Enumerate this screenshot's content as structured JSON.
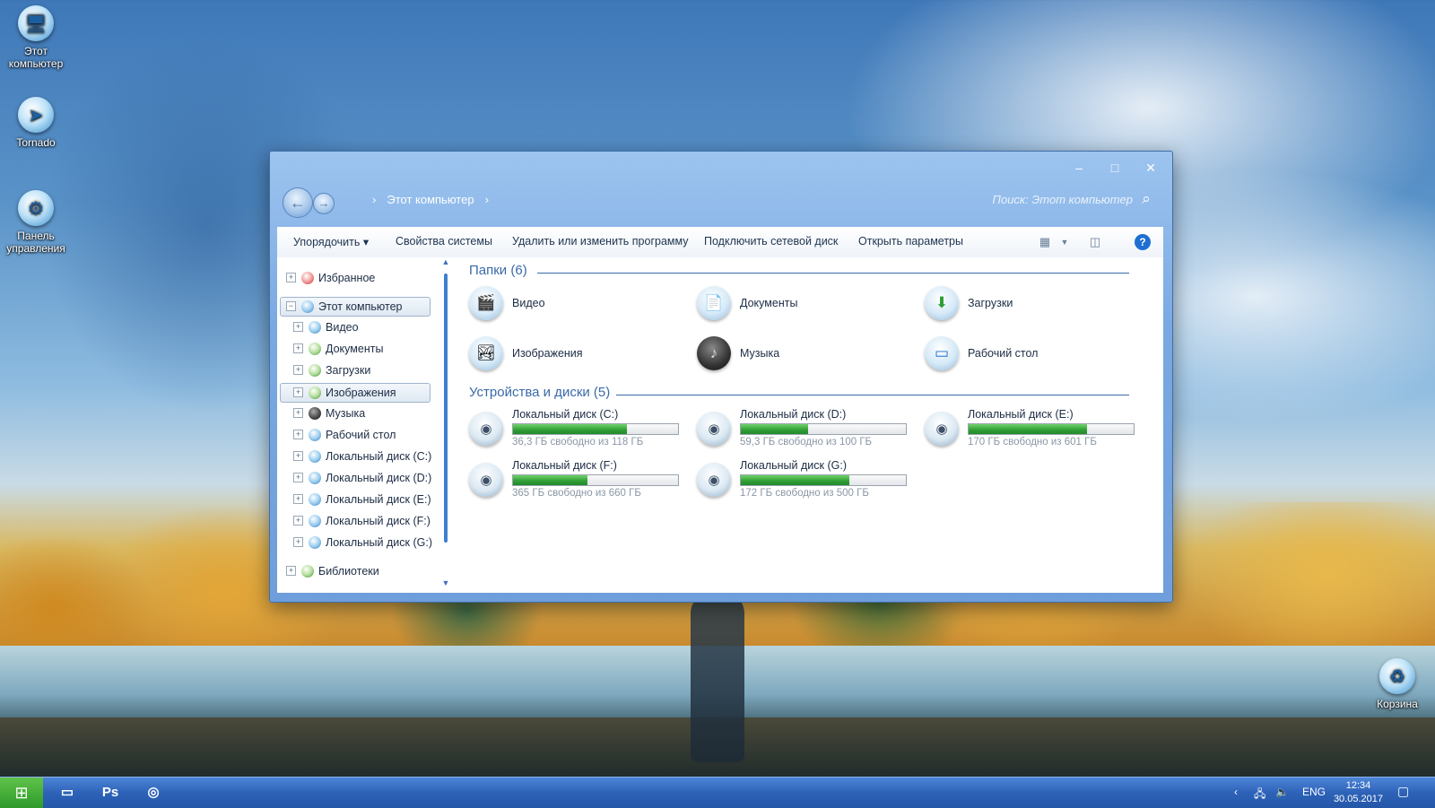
{
  "desktop": {
    "icons": [
      {
        "label": "Этот компьютер"
      },
      {
        "label": "Tornado"
      },
      {
        "label": "Панель управления"
      },
      {
        "label": "Корзина"
      }
    ]
  },
  "window": {
    "controls": {
      "minimize": "–",
      "maximize": "□",
      "close": "✕"
    },
    "breadcrumb": {
      "sep": "›",
      "current": "Этот компьютер"
    },
    "search_placeholder": "Поиск: Этот компьютер",
    "toolbar": {
      "organize": "Упорядочить ▾",
      "system_properties": "Свойства системы",
      "uninstall": "Удалить или изменить программу",
      "map_drive": "Подключить сетевой диск",
      "open_settings": "Открыть параметры",
      "help": "?"
    },
    "sidebar": {
      "favorites": "Избранное",
      "this_pc": "Этот компьютер",
      "items": [
        "Видео",
        "Документы",
        "Загрузки",
        "Изображения",
        "Музыка",
        "Рабочий стол",
        "Локальный диск (C:)",
        "Локальный диск (D:)",
        "Локальный диск (E:)",
        "Локальный диск (F:)",
        "Локальный диск (G:)"
      ],
      "libraries": "Библиотеки",
      "selected": "Изображения"
    },
    "folders": {
      "heading": "Папки (6)",
      "items": [
        {
          "label": "Видео"
        },
        {
          "label": "Документы"
        },
        {
          "label": "Загрузки"
        },
        {
          "label": "Изображения"
        },
        {
          "label": "Музыка"
        },
        {
          "label": "Рабочий стол"
        }
      ]
    },
    "drives": {
      "heading": "Устройства и диски (5)",
      "items": [
        {
          "name": "Локальный диск (C:)",
          "free": "36,3 ГБ свободно из 118 ГБ",
          "used_fraction": 0.69
        },
        {
          "name": "Локальный диск (D:)",
          "free": "59,3 ГБ свободно из 100 ГБ",
          "used_fraction": 0.41
        },
        {
          "name": "Локальный диск (E:)",
          "free": "170 ГБ свободно из 601 ГБ",
          "used_fraction": 0.72
        },
        {
          "name": "Локальный диск (F:)",
          "free": "365 ГБ свободно из 660 ГБ",
          "used_fraction": 0.45
        },
        {
          "name": "Локальный диск (G:)",
          "free": "172 ГБ свободно из 500 ГБ",
          "used_fraction": 0.66
        }
      ]
    }
  },
  "taskbar": {
    "ps_label": "Ps",
    "lang": "ENG",
    "time": "12:34",
    "date": "30.05.2017"
  },
  "colors": {
    "accent": "#3a6aa8",
    "bar_fill": "#2f9c34",
    "taskbar": "#2d62b8"
  }
}
